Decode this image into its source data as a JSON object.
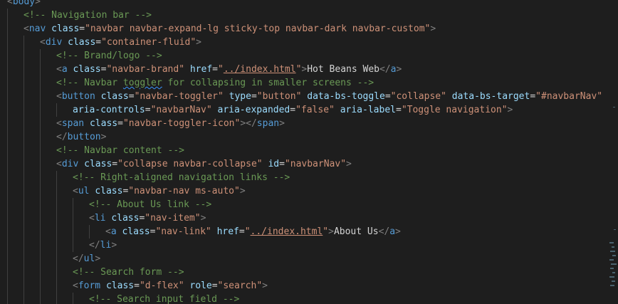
{
  "colors": {
    "background": "#1e1e1e",
    "tag": "#569cd6",
    "attribute": "#9cdcfe",
    "string": "#ce9178",
    "comment": "#6a9955",
    "punctuation": "#808080",
    "text": "#d4d4d4"
  },
  "lines": [
    {
      "indent": 0,
      "tokens": [
        {
          "t": "pun",
          "v": "<"
        },
        {
          "t": "tag",
          "v": "body"
        },
        {
          "t": "pun",
          "v": ">"
        }
      ]
    },
    {
      "indent": 1,
      "tokens": [
        {
          "t": "cmt",
          "v": "<!-- Navigation bar -->"
        }
      ]
    },
    {
      "indent": 1,
      "tokens": [
        {
          "t": "pun",
          "v": "<"
        },
        {
          "t": "tag",
          "v": "nav"
        },
        {
          "t": "txt",
          "v": " "
        },
        {
          "t": "attr",
          "v": "class"
        },
        {
          "t": "txt",
          "v": "="
        },
        {
          "t": "str",
          "v": "\"navbar navbar-expand-lg sticky-top navbar-dark navbar-custom\""
        },
        {
          "t": "pun",
          "v": ">"
        }
      ]
    },
    {
      "indent": 2,
      "tokens": [
        {
          "t": "pun",
          "v": "<"
        },
        {
          "t": "tag",
          "v": "div"
        },
        {
          "t": "txt",
          "v": " "
        },
        {
          "t": "attr",
          "v": "class"
        },
        {
          "t": "txt",
          "v": "="
        },
        {
          "t": "str",
          "v": "\"container-fluid\""
        },
        {
          "t": "pun",
          "v": ">"
        }
      ]
    },
    {
      "indent": 3,
      "tokens": [
        {
          "t": "cmt",
          "v": "<!-- Brand/logo -->"
        }
      ]
    },
    {
      "indent": 3,
      "tokens": [
        {
          "t": "pun",
          "v": "<"
        },
        {
          "t": "tag",
          "v": "a"
        },
        {
          "t": "txt",
          "v": " "
        },
        {
          "t": "attr",
          "v": "class"
        },
        {
          "t": "txt",
          "v": "="
        },
        {
          "t": "str",
          "v": "\"navbar-brand\""
        },
        {
          "t": "txt",
          "v": " "
        },
        {
          "t": "attr",
          "v": "href"
        },
        {
          "t": "txt",
          "v": "="
        },
        {
          "t": "str",
          "v": "\""
        },
        {
          "t": "link",
          "v": "../index.html"
        },
        {
          "t": "str",
          "v": "\""
        },
        {
          "t": "pun",
          "v": ">"
        },
        {
          "t": "txt",
          "v": "Hot Beans Web"
        },
        {
          "t": "pun",
          "v": "</"
        },
        {
          "t": "tag",
          "v": "a"
        },
        {
          "t": "pun",
          "v": ">"
        }
      ]
    },
    {
      "indent": 3,
      "tokens": [
        {
          "t": "cmt",
          "v": "<!-- Navbar "
        },
        {
          "t": "cmtsq",
          "v": "toggler"
        },
        {
          "t": "cmt",
          "v": " for collapsing in smaller screens -->"
        }
      ]
    },
    {
      "indent": 3,
      "tokens": [
        {
          "t": "pun",
          "v": "<"
        },
        {
          "t": "tag",
          "v": "button"
        },
        {
          "t": "txt",
          "v": " "
        },
        {
          "t": "attr",
          "v": "class"
        },
        {
          "t": "txt",
          "v": "="
        },
        {
          "t": "str",
          "v": "\"navbar-toggler\""
        },
        {
          "t": "txt",
          "v": " "
        },
        {
          "t": "attr",
          "v": "type"
        },
        {
          "t": "txt",
          "v": "="
        },
        {
          "t": "str",
          "v": "\"button\""
        },
        {
          "t": "txt",
          "v": " "
        },
        {
          "t": "attr",
          "v": "data-bs-toggle"
        },
        {
          "t": "txt",
          "v": "="
        },
        {
          "t": "str",
          "v": "\"collapse\""
        },
        {
          "t": "txt",
          "v": " "
        },
        {
          "t": "attr",
          "v": "data-bs-target"
        },
        {
          "t": "txt",
          "v": "="
        },
        {
          "t": "str",
          "v": "\"#navbarNav\""
        }
      ]
    },
    {
      "indent": 4,
      "tokens": [
        {
          "t": "attr",
          "v": "aria-controls"
        },
        {
          "t": "txt",
          "v": "="
        },
        {
          "t": "str",
          "v": "\"navbarNav\""
        },
        {
          "t": "txt",
          "v": " "
        },
        {
          "t": "attr",
          "v": "aria-expanded"
        },
        {
          "t": "txt",
          "v": "="
        },
        {
          "t": "str",
          "v": "\"false\""
        },
        {
          "t": "txt",
          "v": " "
        },
        {
          "t": "attr",
          "v": "aria-label"
        },
        {
          "t": "txt",
          "v": "="
        },
        {
          "t": "str",
          "v": "\"Toggle navigation\""
        },
        {
          "t": "pun",
          "v": ">"
        }
      ]
    },
    {
      "indent": 3,
      "tokens": [
        {
          "t": "pun",
          "v": "<"
        },
        {
          "t": "tag",
          "v": "span"
        },
        {
          "t": "txt",
          "v": " "
        },
        {
          "t": "attr",
          "v": "class"
        },
        {
          "t": "txt",
          "v": "="
        },
        {
          "t": "str",
          "v": "\"navbar-toggler-icon\""
        },
        {
          "t": "pun",
          "v": "></"
        },
        {
          "t": "tag",
          "v": "span"
        },
        {
          "t": "pun",
          "v": ">"
        }
      ]
    },
    {
      "indent": 3,
      "tokens": [
        {
          "t": "pun",
          "v": "</"
        },
        {
          "t": "tag",
          "v": "button"
        },
        {
          "t": "pun",
          "v": ">"
        }
      ]
    },
    {
      "indent": 3,
      "tokens": [
        {
          "t": "cmt",
          "v": "<!-- Navbar content -->"
        }
      ]
    },
    {
      "indent": 3,
      "tokens": [
        {
          "t": "pun",
          "v": "<"
        },
        {
          "t": "tag",
          "v": "div"
        },
        {
          "t": "txt",
          "v": " "
        },
        {
          "t": "attr",
          "v": "class"
        },
        {
          "t": "txt",
          "v": "="
        },
        {
          "t": "str",
          "v": "\"collapse navbar-collapse\""
        },
        {
          "t": "txt",
          "v": " "
        },
        {
          "t": "attr",
          "v": "id"
        },
        {
          "t": "txt",
          "v": "="
        },
        {
          "t": "str",
          "v": "\"navbarNav\""
        },
        {
          "t": "pun",
          "v": ">"
        }
      ]
    },
    {
      "indent": 4,
      "tokens": [
        {
          "t": "cmt",
          "v": "<!-- Right-aligned navigation links -->"
        }
      ]
    },
    {
      "indent": 4,
      "tokens": [
        {
          "t": "pun",
          "v": "<"
        },
        {
          "t": "tag",
          "v": "ul"
        },
        {
          "t": "txt",
          "v": " "
        },
        {
          "t": "attr",
          "v": "class"
        },
        {
          "t": "txt",
          "v": "="
        },
        {
          "t": "str",
          "v": "\"navbar-nav ms-auto\""
        },
        {
          "t": "pun",
          "v": ">"
        }
      ]
    },
    {
      "indent": 5,
      "tokens": [
        {
          "t": "cmt",
          "v": "<!-- About Us link -->"
        }
      ]
    },
    {
      "indent": 5,
      "tokens": [
        {
          "t": "pun",
          "v": "<"
        },
        {
          "t": "tag",
          "v": "li"
        },
        {
          "t": "txt",
          "v": " "
        },
        {
          "t": "attr",
          "v": "class"
        },
        {
          "t": "txt",
          "v": "="
        },
        {
          "t": "str",
          "v": "\"nav-item\""
        },
        {
          "t": "pun",
          "v": ">"
        }
      ]
    },
    {
      "indent": 6,
      "tokens": [
        {
          "t": "pun",
          "v": "<"
        },
        {
          "t": "tag",
          "v": "a"
        },
        {
          "t": "txt",
          "v": " "
        },
        {
          "t": "attr",
          "v": "class"
        },
        {
          "t": "txt",
          "v": "="
        },
        {
          "t": "str",
          "v": "\"nav-link\""
        },
        {
          "t": "txt",
          "v": " "
        },
        {
          "t": "attr",
          "v": "href"
        },
        {
          "t": "txt",
          "v": "="
        },
        {
          "t": "str",
          "v": "\""
        },
        {
          "t": "link",
          "v": "../index.html"
        },
        {
          "t": "str",
          "v": "\""
        },
        {
          "t": "pun",
          "v": ">"
        },
        {
          "t": "txt",
          "v": "About Us"
        },
        {
          "t": "pun",
          "v": "</"
        },
        {
          "t": "tag",
          "v": "a"
        },
        {
          "t": "pun",
          "v": ">"
        }
      ]
    },
    {
      "indent": 5,
      "tokens": [
        {
          "t": "pun",
          "v": "</"
        },
        {
          "t": "tag",
          "v": "li"
        },
        {
          "t": "pun",
          "v": ">"
        }
      ]
    },
    {
      "indent": 4,
      "tokens": [
        {
          "t": "pun",
          "v": "</"
        },
        {
          "t": "tag",
          "v": "ul"
        },
        {
          "t": "pun",
          "v": ">"
        }
      ]
    },
    {
      "indent": 4,
      "tokens": [
        {
          "t": "cmt",
          "v": "<!-- Search form -->"
        }
      ]
    },
    {
      "indent": 4,
      "tokens": [
        {
          "t": "pun",
          "v": "<"
        },
        {
          "t": "tag",
          "v": "form"
        },
        {
          "t": "txt",
          "v": " "
        },
        {
          "t": "attr",
          "v": "class"
        },
        {
          "t": "txt",
          "v": "="
        },
        {
          "t": "str",
          "v": "\"d-flex\""
        },
        {
          "t": "txt",
          "v": " "
        },
        {
          "t": "attr",
          "v": "role"
        },
        {
          "t": "txt",
          "v": "="
        },
        {
          "t": "str",
          "v": "\"search\""
        },
        {
          "t": "pun",
          "v": ">"
        }
      ]
    },
    {
      "indent": 5,
      "tokens": [
        {
          "t": "cmt",
          "v": "<!-- Search input field -->"
        }
      ]
    }
  ]
}
